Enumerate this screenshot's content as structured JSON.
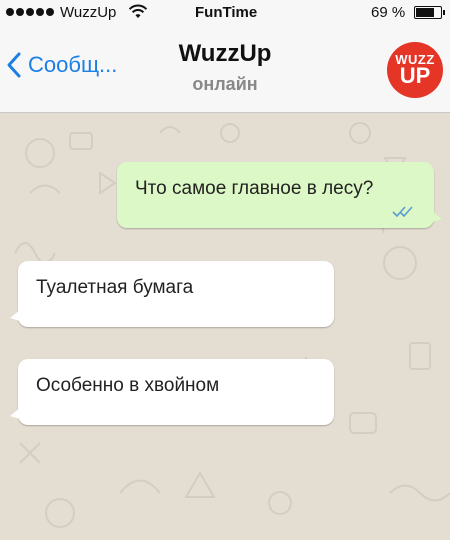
{
  "status_bar": {
    "carrier": "WuzzUp",
    "time": "FunTime",
    "battery": "69 %",
    "battery_level": 0.69
  },
  "header": {
    "back_label": "Сообщ...",
    "title": "WuzzUp",
    "subtitle": "онлайн",
    "logo_line1": "WUZZ",
    "logo_line2": "UP",
    "logo_color": "#e53527"
  },
  "messages": [
    {
      "direction": "outgoing",
      "text": "Что самое главное в лесу?",
      "status_icon": "double-check-icon"
    },
    {
      "direction": "incoming",
      "text": "Туалетная бумага"
    },
    {
      "direction": "incoming",
      "text": "Особенно в хвойном"
    }
  ],
  "colors": {
    "accent": "#1b7fe6",
    "outgoing_bubble": "#dcf8c6",
    "incoming_bubble": "#ffffff",
    "chat_background": "#e4ddd2",
    "read_ticks": "#5b9bd5"
  }
}
